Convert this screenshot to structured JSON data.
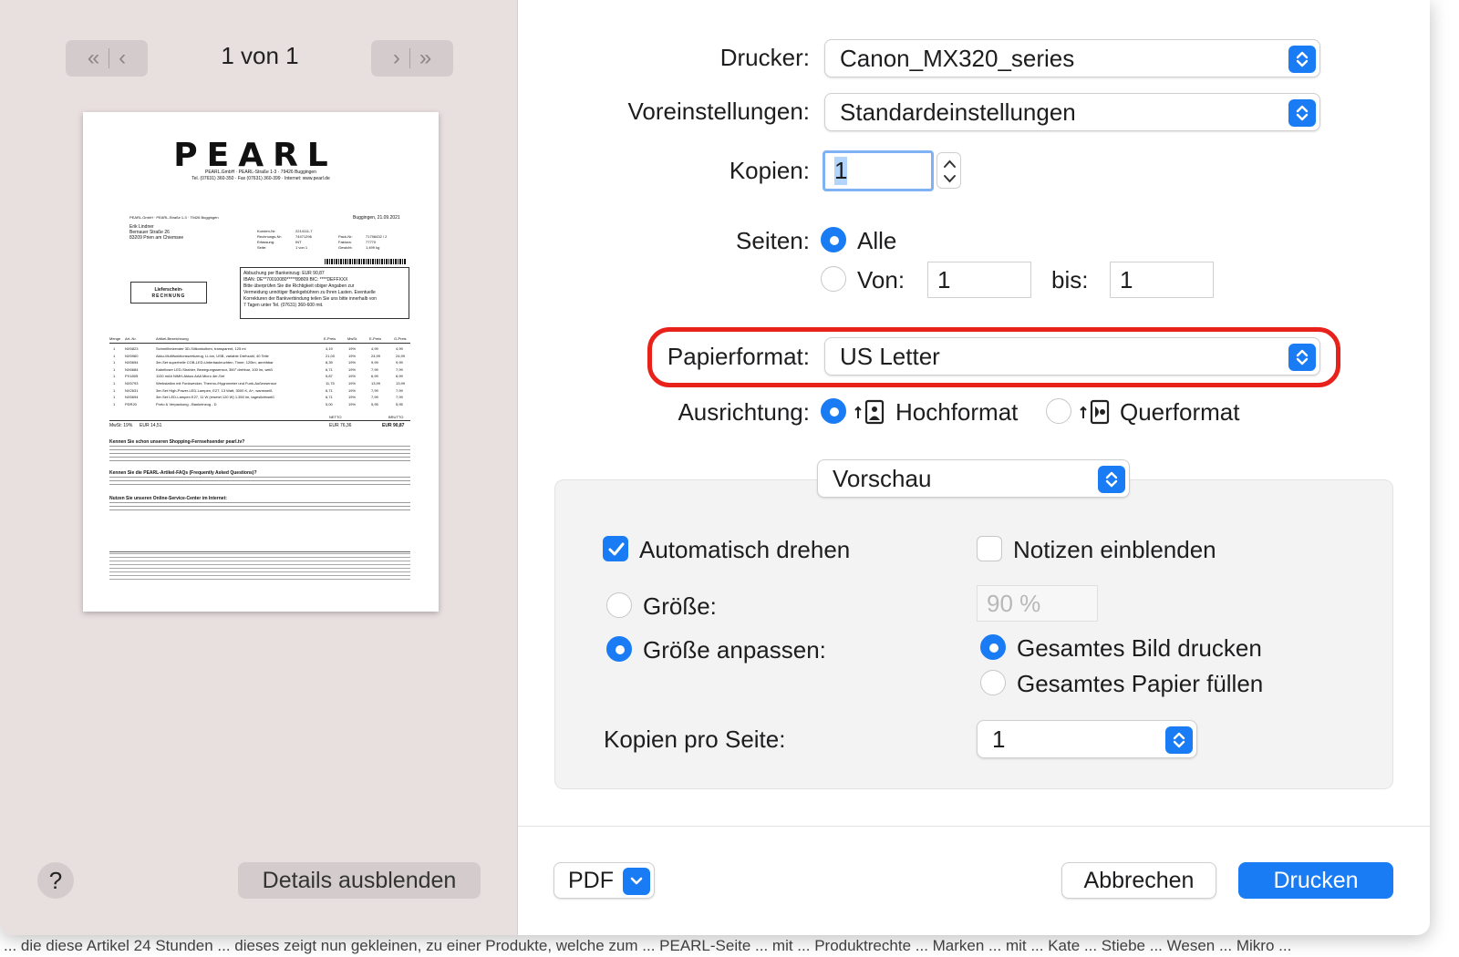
{
  "background_bottom_text": "... die diese Artikel 24 Stunden ... dieses zeigt nun gekleinen, zu einer Produkte, welche zum ... PEARL-Seite ... mit ... Produktrechte ... Marken ... mit ... Kate ... Stiebe ... Wesen ... Mikro ...",
  "preview": {
    "page_counter": "1 von 1",
    "details_button": "Details ausblenden",
    "help_symbol": "?",
    "document": {
      "logo": "PEARL",
      "sender_line1": "PEARL.GmbH · PEARL-Straße 1-3 · 79426 Buggingen",
      "sender_line2": "Tel. (07631) 360-350 · Fax (07631) 360-399 · Internet: www.pearl.de",
      "return_address": "PEARL.GmbH · PEARL-Straße 1-3 · 79426 Buggingen",
      "date": "Buggingen, 21.09.2021",
      "recipient": [
        "Erik Lindner",
        "Bernauer Straße 26",
        "83209 Prien am Chiemsee"
      ],
      "meta_labels": [
        "Kunden-Nr:",
        "Rechnungs-Nr:",
        "Erfassung:",
        "Seite:"
      ],
      "meta_values": [
        "2214111-7",
        "74471296",
        "INT",
        "1 von 1"
      ],
      "meta_labels2": [
        "Pack-Nr:",
        "Faktura:",
        "Gewicht:"
      ],
      "meta_values2": [
        "71798432 / 2",
        "77770",
        "1,499 kg"
      ],
      "doc_type_line1": "Lieferschein-",
      "doc_type_line2": "RECHNUNG",
      "payment_box": [
        "Abbuchung per Bankeinzug: EUR 90,87",
        "IBAN: DE**70010080*****89809 BIC: ****DEFFXXX",
        "Bitte überprüfen Sie die Richtigkeit obiger Angaben zur",
        "Vermeidung unnötiger Bankgebühren zu Ihren Lasten. Eventuelle",
        "Korrekturen der Bankverbindung teilen Sie uns bitte innerhalb von",
        "7 Tagen unter Tel. (07631) 360-600 mit."
      ],
      "table_headers": [
        "Menge",
        "Art.-Nr.",
        "Artikel-Bezeichnung",
        "E-Preis",
        "MwSt.",
        "E-Preis",
        "G-Preis"
      ],
      "table_rows": [
        [
          "1",
          "NX5823",
          "Schnellheizender 3D-Silikonkolben, transparent, 125 ml",
          "4,19",
          "19%",
          "4,99",
          "4,99"
        ],
        [
          "1",
          "NX5960",
          "Akku-Multifunktionswerkzeug, Li-Ion, USB, variable Drehzahl, 40 Teile",
          "21,00",
          "19%",
          "24,99",
          "24,99"
        ],
        [
          "1",
          "NX5694",
          "3er-Set superhelle COB-LED-Unterbauleuchten, Timer, 120lm, anreihbar",
          "8,39",
          "19%",
          "9,99",
          "9,99"
        ],
        [
          "1",
          "NX6684",
          "Kabelloser LED-Strahler, Bewegungssensor, 360° drehbar, 100 lm, weiß",
          "6,71",
          "19%",
          "7,99",
          "7,99"
        ],
        [
          "1",
          "PX1805",
          "1100 mAh NiMH-Akkus AAA Micro 4er-Set",
          "5,87",
          "19%",
          "6,99",
          "6,99"
        ],
        [
          "1",
          "NX5793",
          "Werkstatlon mit Funkwecker, Thermo-/Hygrometer und Funk-Außensensor",
          "11,75",
          "19%",
          "13,99",
          "13,99"
        ],
        [
          "1",
          "NX2631",
          "3er-Set High-Power-LED-Lampen, E27, 13 Watt, 3000 K, A+, warmweiß",
          "6,71",
          "19%",
          "7,99",
          "7,99"
        ],
        [
          "1",
          "NX5694",
          "3er-Set LED-Lampen E27, 11 W (ersetzt 120 W) 1.350 lm, tageslichtweiß",
          "6,71",
          "19%",
          "7,99",
          "7,99"
        ],
        [
          "1",
          "PDR20",
          "Porto & Verpackung - Bankeinzug - D",
          "5,00",
          "19%",
          "5,95",
          "5,95"
        ]
      ],
      "totals": {
        "mwst": "MwSt: 19%",
        "mwst_value": "EUR 14,51",
        "netto_label": "NETTO",
        "netto": "EUR 76,36",
        "brutto_label": "BRUTTO",
        "brutto": "EUR 90,87"
      },
      "section1_title": "Kennen Sie schon unseren Shopping-Fernsehsender pearl.tv?",
      "section2_title": "Kennen Sie die PEARL-Artikel-FAQs (Frequently Asked Questions)?",
      "section3_title": "Nutzen Sie unseren Online-Service-Center im Internet:"
    }
  },
  "form": {
    "printer_label": "Drucker:",
    "printer_value": "Canon_MX320_series",
    "presets_label": "Voreinstellungen:",
    "presets_value": "Standardeinstellungen",
    "copies_label": "Kopien:",
    "copies_value": "1",
    "pages_label": "Seiten:",
    "pages_all": "Alle",
    "pages_from_label": "Von:",
    "pages_from_value": "1",
    "pages_to_label": "bis:",
    "pages_to_value": "1",
    "paper_label": "Papierformat:",
    "paper_value": "US Letter",
    "orientation_label": "Ausrichtung:",
    "orientation_portrait": "Hochformat",
    "orientation_landscape": "Querformat",
    "section_value": "Vorschau"
  },
  "panel": {
    "auto_rotate": "Automatisch drehen",
    "show_notes": "Notizen einblenden",
    "scale_label": "Größe:",
    "scale_value": "90 %",
    "scale_to_fit": "Größe anpassen:",
    "print_entire": "Gesamtes Bild drucken",
    "fill_paper": "Gesamtes Papier füllen",
    "copies_per_page_label": "Kopien pro Seite:",
    "copies_per_page_value": "1"
  },
  "footer": {
    "pdf": "PDF",
    "cancel": "Abbrechen",
    "print": "Drucken"
  },
  "colors": {
    "accent": "#1a7cf5",
    "highlight": "#e8221b",
    "preview_bg": "#e8dfdf"
  }
}
